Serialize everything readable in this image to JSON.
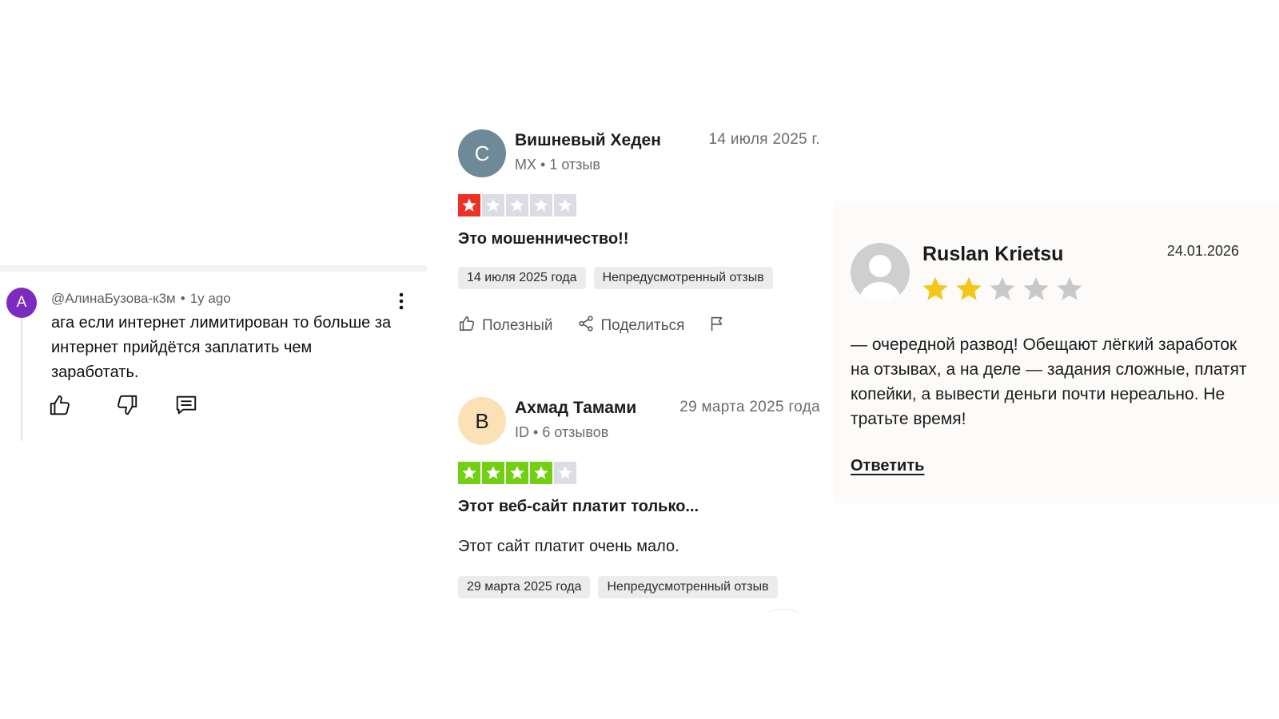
{
  "youtube_comment": {
    "avatar_letter": "A",
    "avatar_color": "#7b2cbf",
    "author": "@АлинаБузова-к3м",
    "time": "1y ago",
    "text": "ага если интернет лимитирован то больше за интернет прийдётся заплатить чем заработать.",
    "actions": [
      "like-icon",
      "dislike-icon",
      "reply-icon"
    ]
  },
  "trustpilot": {
    "reviews": [
      {
        "avatar_letter": "С",
        "avatar_color": "#6e8a99",
        "avatar_text_color": "#ffffff",
        "name": "Вишневый Хеден",
        "date": "14 июля 2025 г.",
        "country": "MX",
        "review_count": "1 отзыв",
        "rating": 1,
        "rating_color": "#ee3124",
        "title": "Это мошенничество!!",
        "body": "",
        "chip_date": "14 июля 2025 года",
        "chip_label": "Непредусмотренный отзыв",
        "helpful_label": "Полезный",
        "share_label": "Поделиться"
      },
      {
        "avatar_letter": "В",
        "avatar_color": "#fce1b6",
        "avatar_text_color": "#1c1c1c",
        "name": "Ахмад Тамами",
        "date": "29 марта 2025 года",
        "country": "ID",
        "review_count": "6 отзывов",
        "rating": 4,
        "rating_color": "#73cf11",
        "title": "Этот веб-сайт платит только...",
        "body": "Этот сайт платит очень мало.",
        "chip_date": "29 марта 2025 года",
        "chip_label": "Непредусмотренный отзыв"
      }
    ]
  },
  "site_review": {
    "name": "Ruslan Krietsu",
    "date": "24.01.2026",
    "rating": 2,
    "max_rating": 5,
    "star_color": "#f5c518",
    "star_empty_color": "#c9c9c9",
    "text": "— очередной развод! Обещают лёгкий заработок на отзывах, а на деле — задания сложные, платят копейки, а вывести деньги почти нереально. Не тратьте время!",
    "reply_label": "Ответить"
  }
}
